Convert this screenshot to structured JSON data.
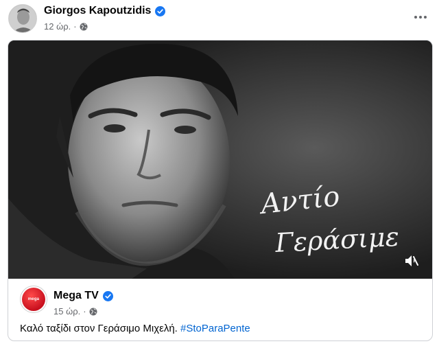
{
  "header": {
    "author_name": "Giorgos Kapoutzidis",
    "time": "12 ώρ.",
    "separator": "·",
    "privacy_icon": "globe-icon",
    "more_icon": "more-options-icon"
  },
  "shared_post": {
    "video_caption_line1": "Αντίο",
    "video_caption_line2": "Γεράσιμε",
    "mute_icon": "speaker-muted-icon",
    "page_name": "Mega TV",
    "page_logo_text": "mega",
    "time": "15 ώρ.",
    "separator": "·",
    "text": "Καλό ταξίδι στον Γεράσιμο Μιχελή.",
    "hashtag": "#StoParaPente"
  },
  "colors": {
    "verified_blue": "#1877f2",
    "hashtag_blue": "#0064d1",
    "meta_gray": "#65676b",
    "mega_red": "#c8101e"
  }
}
